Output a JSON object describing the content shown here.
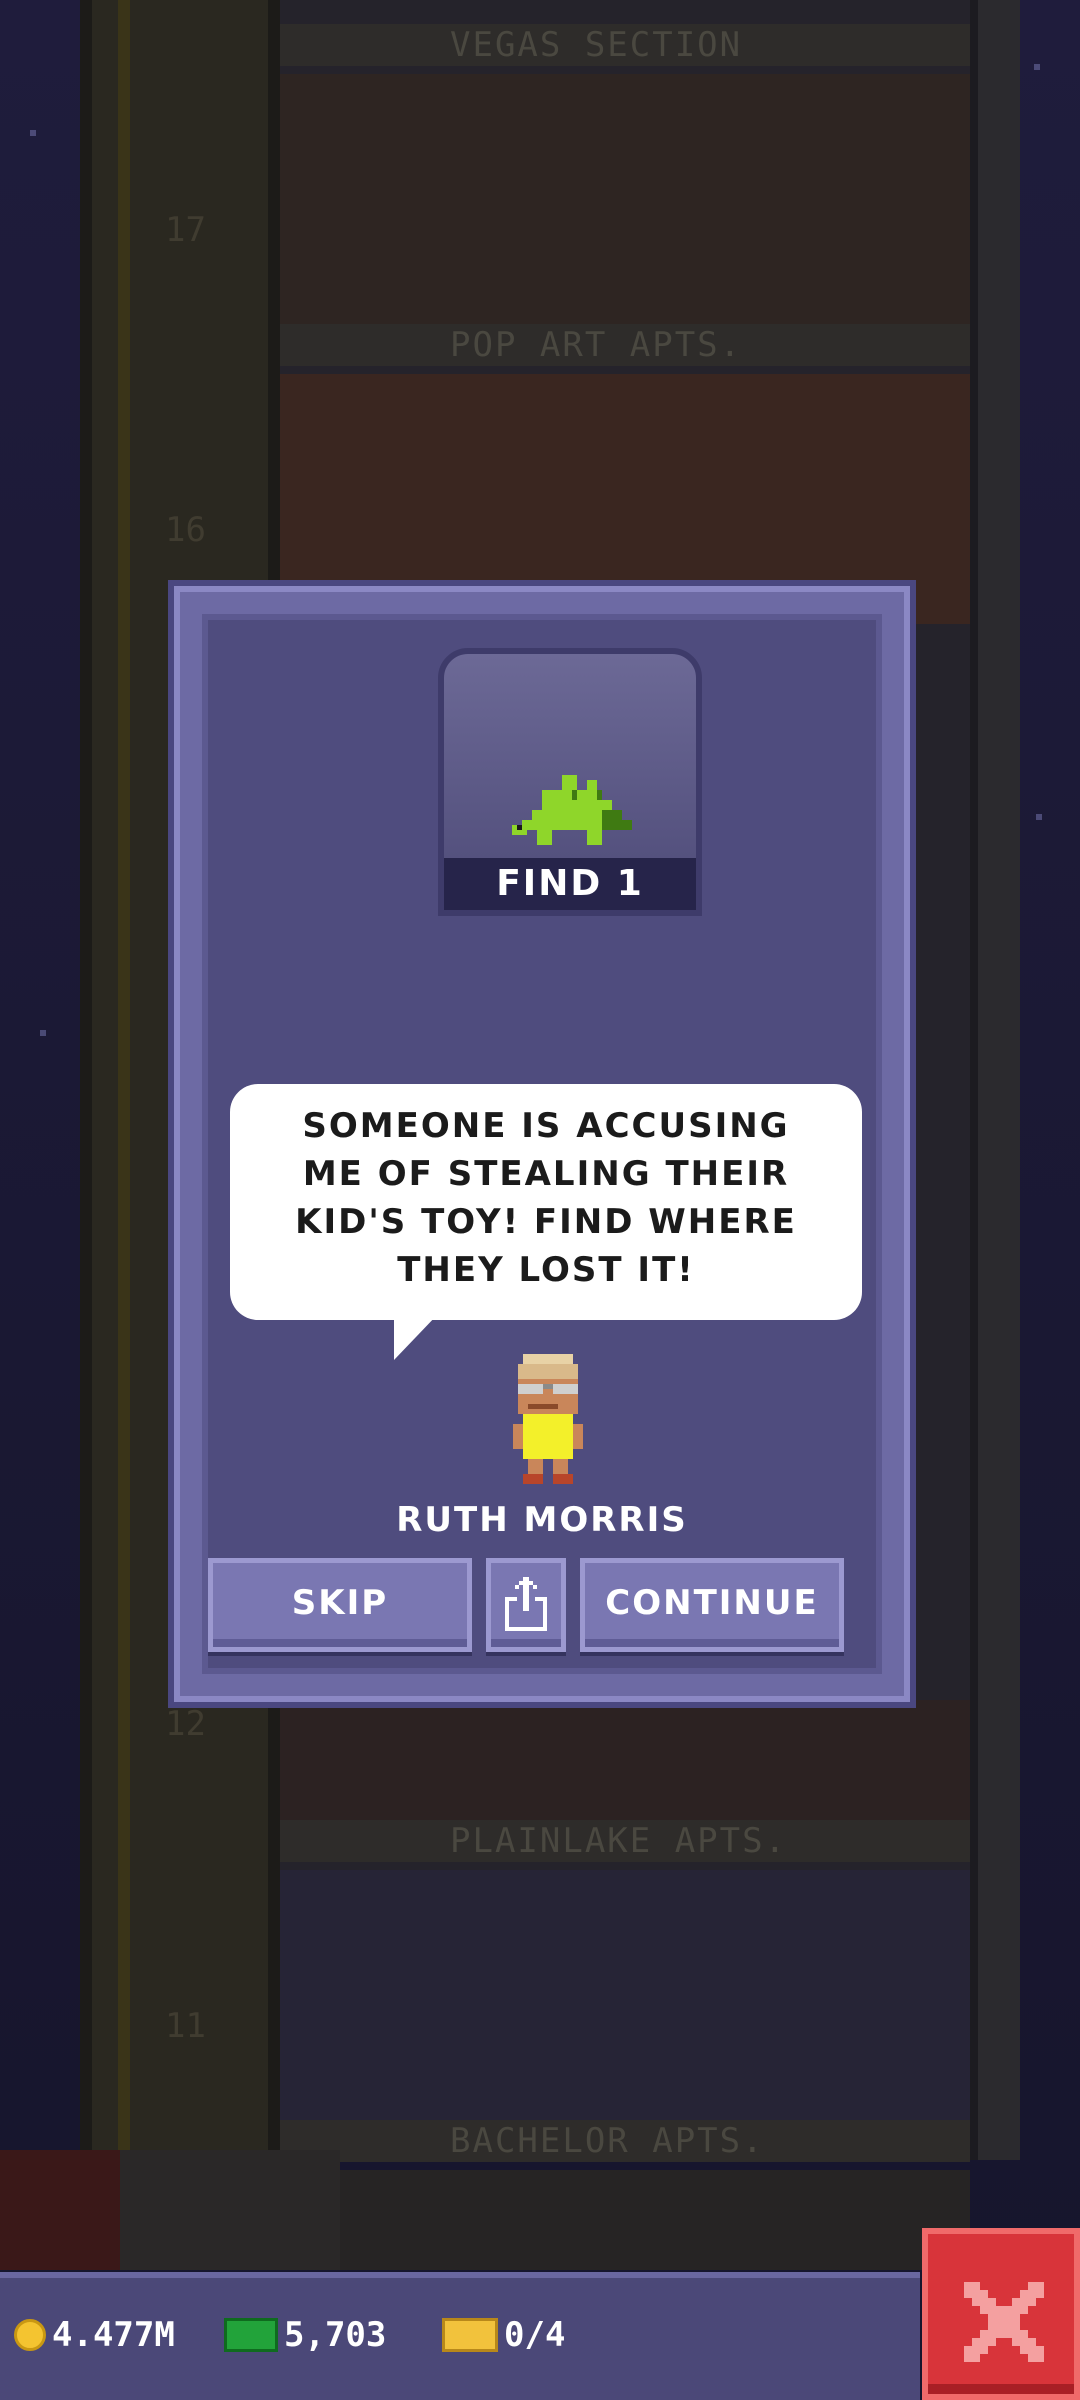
{
  "mission": {
    "item_caption": "FIND 1",
    "item_icon": "green-stegosaurus-toy-icon",
    "message": "SOMEONE IS ACCUSING ME OF STEALING THEIR KID'S TOY! FIND WHERE THEY LOST IT!",
    "character_name": "RUTH MORRIS",
    "buttons": {
      "skip": "SKIP",
      "share_icon": "share-icon",
      "continue": "CONTINUE"
    }
  },
  "tower": {
    "floors": [
      {
        "number": "17",
        "name": "VEGAS SECTION"
      },
      {
        "number": "16",
        "name": "POP ART APTS."
      },
      {
        "number": "12",
        "name": ""
      },
      {
        "number": "11",
        "name": "PLAINLAKE APTS."
      },
      {
        "number": "",
        "name": "BACHELOR APTS."
      }
    ]
  },
  "status_bar": {
    "coins": "4.477M",
    "bux": "5,703",
    "tickets": "0/4"
  },
  "colors": {
    "dialog": "#4f4c7e",
    "button": "#7a77b2",
    "close": "#d8343a",
    "item_green": "#8fd62a"
  }
}
